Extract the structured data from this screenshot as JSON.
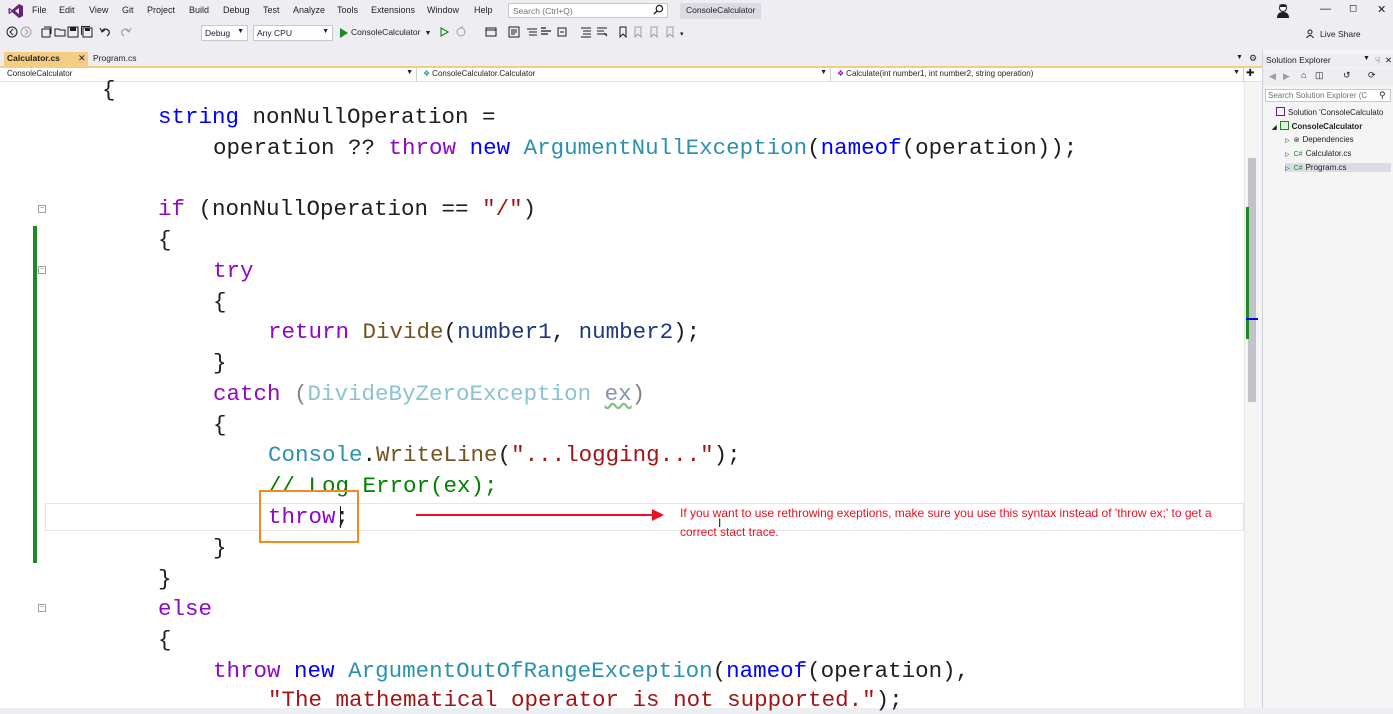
{
  "menu": {
    "items": [
      "File",
      "Edit",
      "View",
      "Git",
      "Project",
      "Build",
      "Debug",
      "Test",
      "Analyze",
      "Tools",
      "Extensions",
      "Window",
      "Help"
    ],
    "search_placeholder": "Search (Ctrl+Q)",
    "solution_name": "ConsoleCalculator"
  },
  "toolbar": {
    "configuration": "Debug",
    "platform": "Any CPU",
    "run_target": "ConsoleCalculator",
    "live_share": "Live Share"
  },
  "tabs": [
    {
      "label": "Calculator.cs",
      "active": true
    },
    {
      "label": "Program.cs",
      "active": false
    }
  ],
  "navbar": {
    "project": "ConsoleCalculator",
    "type": "ConsoleCalculator.Calculator",
    "member": "Calculate(int number1, int number2, string operation)"
  },
  "code": {
    "l0": "{",
    "l1_kw": "string",
    "l1_rest": " nonNullOperation =",
    "l2_a": "operation ?? ",
    "l2_throw": "throw",
    "l2_sp": " ",
    "l2_new": "new",
    "l2_sp2": " ",
    "l2_type": "ArgumentNullException",
    "l2_p1": "(",
    "l2_nameof": "nameof",
    "l2_p2": "(operation));",
    "l3_if": "if",
    "l3_a": " (nonNullOperation == ",
    "l3_str": "\"/\"",
    "l3_b": ")",
    "l4": "{",
    "l5_try": "try",
    "l6": "{",
    "l7_return": "return",
    "l7_sp": " ",
    "l7_fn": "Divide",
    "l7_a": "(",
    "l7_p1": "number1",
    "l7_b": ", ",
    "l7_p2": "number2",
    "l7_c": ");",
    "l8": "}",
    "l9_catch": "catch",
    "l9_a": " (",
    "l9_type": "DivideByZeroException",
    "l9_sp": " ",
    "l9_var": "ex",
    "l9_b": ")",
    "l10": "{",
    "l11_type": "Console",
    "l11_dot": ".",
    "l11_fn": "WriteLine",
    "l11_a": "(",
    "l11_str": "\"...logging...\"",
    "l11_b": ");",
    "l12_comment": "// Log Error(ex);",
    "l13_throw": "throw",
    "l13_semi": ";",
    "l14": "}",
    "l15": "}",
    "l16_else": "else",
    "l17": "{",
    "l18_throw": "throw",
    "l18_sp": " ",
    "l18_new": "new",
    "l18_sp2": " ",
    "l18_type": "ArgumentOutOfRangeException",
    "l18_a": "(",
    "l18_nameof": "nameof",
    "l18_b": "(operation),",
    "l19_str": "\"The mathematical operator is not supported.\"",
    "l19_b": ");"
  },
  "annotation": "If you want to use rethrowing exeptions, make sure you use this syntax instead of 'throw ex;' to get a correct stact trace.",
  "solution_explorer": {
    "title": "Solution Explorer",
    "search_placeholder": "Search Solution Explorer (C",
    "solution": "Solution 'ConsoleCalculato",
    "project": "ConsoleCalculator",
    "dependencies": "Dependencies",
    "file1": "Calculator.cs",
    "file2": "Program.cs"
  },
  "colors": {
    "active_tab": "#f5cc84",
    "highlight_box": "#f18a1f",
    "annotation": "#e81123",
    "keyword_control": "#8f08c4",
    "keyword": "#0000ff",
    "type": "#2b91af",
    "string": "#a31515",
    "comment": "#008000"
  }
}
